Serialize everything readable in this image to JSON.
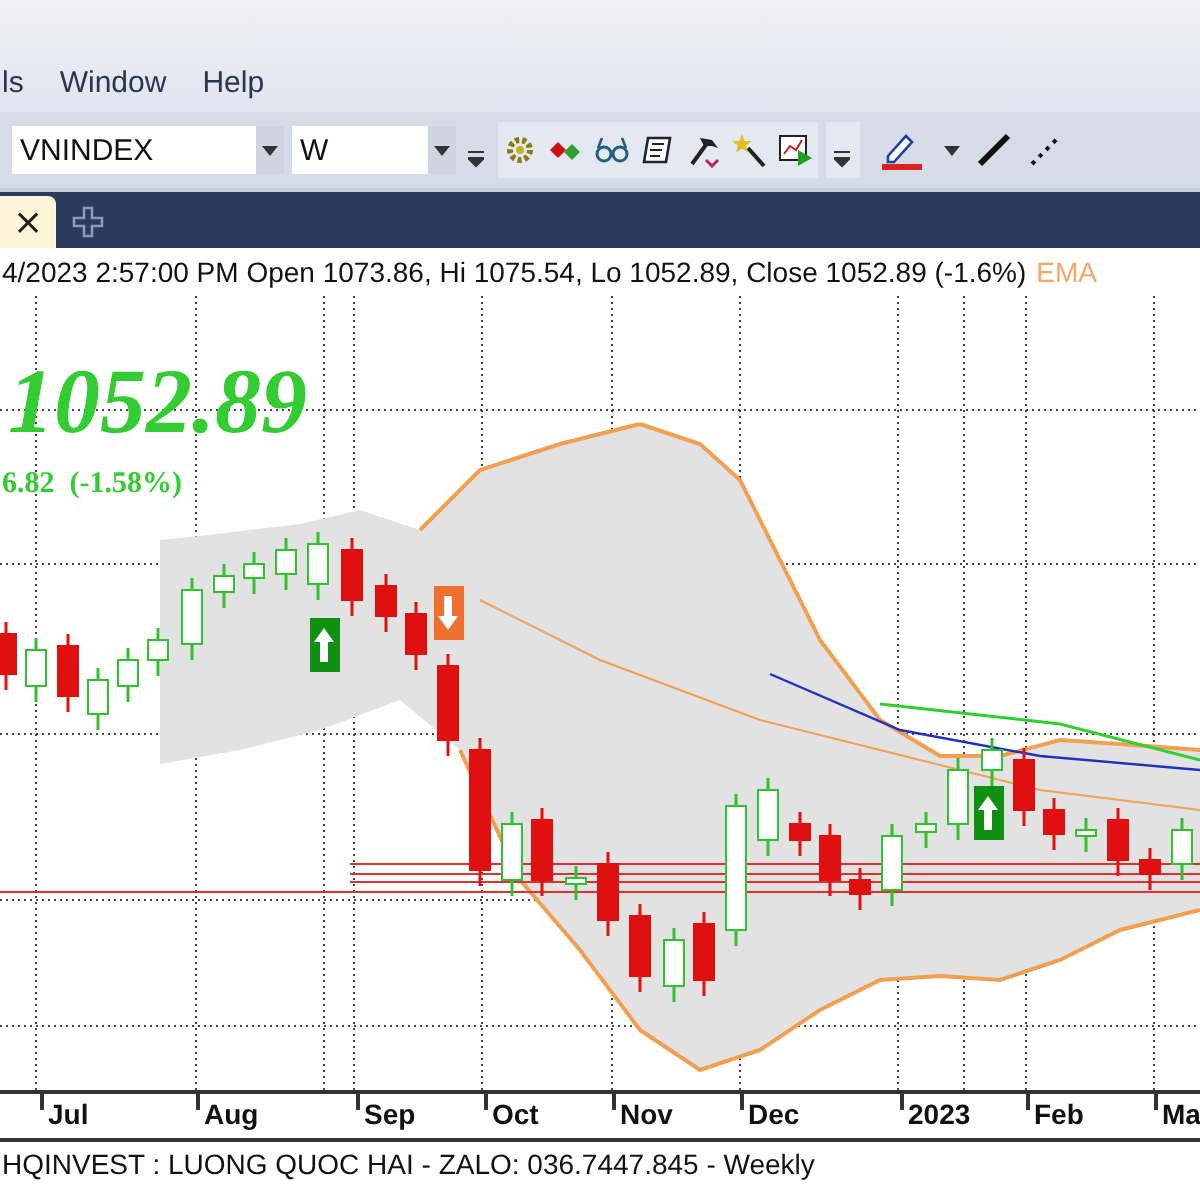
{
  "menu": [
    {
      "label": "ls"
    },
    {
      "label": "Window"
    },
    {
      "label": "Help"
    }
  ],
  "toolbar": {
    "symbol": "VNINDEX",
    "interval": "W"
  },
  "tab_bar": {
    "close": "×"
  },
  "quote_line": {
    "text": "4/2023 2:57:00 PM Open 1073.86, Hi 1075.54, Lo 1052.89, Close 1052.89 (-1.6%)",
    "indicator": "EMA"
  },
  "price": {
    "last": "1052.89",
    "change": "6.82  (-1.58%)"
  },
  "x_axis": [
    "Jul",
    "Aug",
    "Sep",
    "Oct",
    "Nov",
    "Dec",
    "2023",
    "Feb",
    "Ma"
  ],
  "footer": "HQINVEST : LUONG QUOC HAI   - ZALO:  036.7447.845 - Weekly"
}
